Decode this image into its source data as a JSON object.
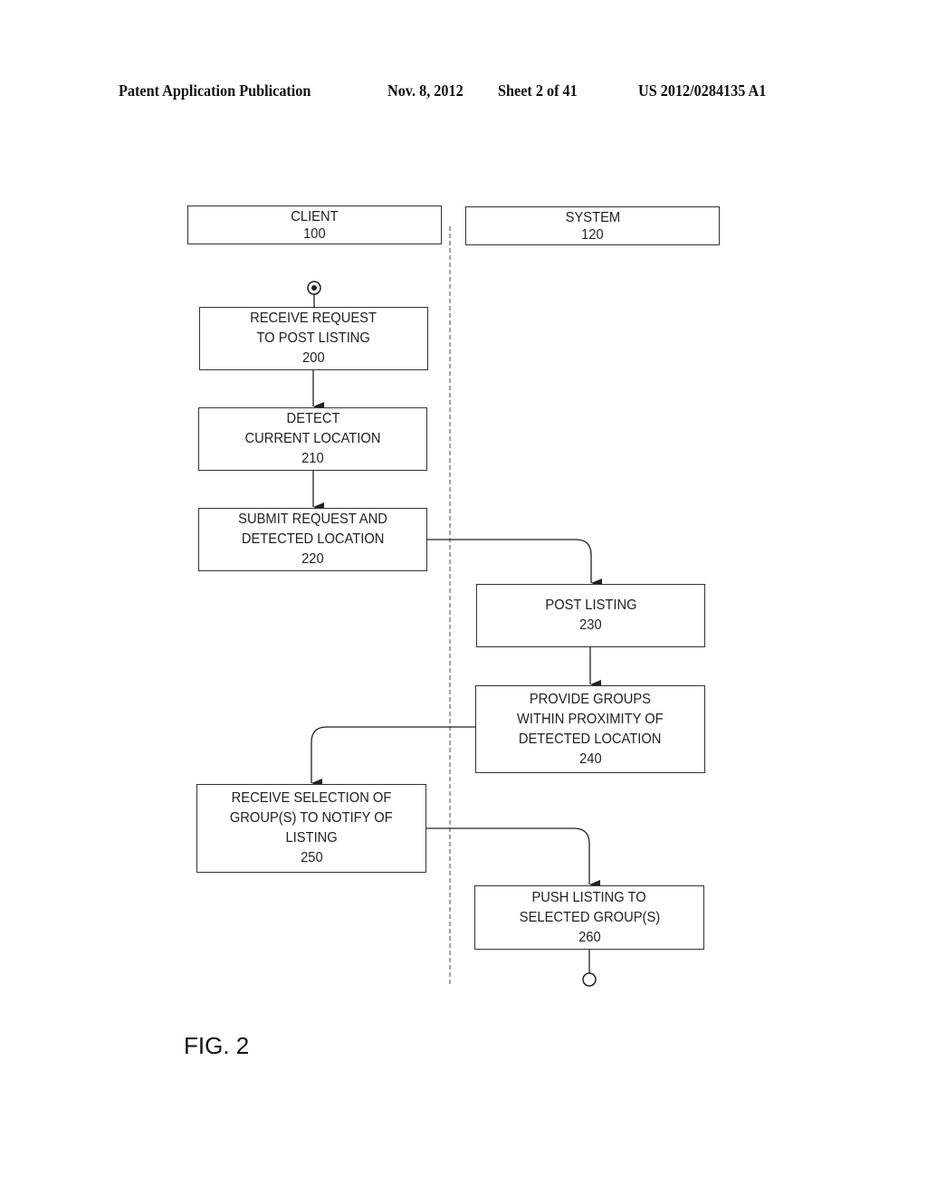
{
  "header": {
    "publication": "Patent Application Publication",
    "date": "Nov. 8, 2012",
    "sheet": "Sheet 2 of 41",
    "number": "US 2012/0284135 A1"
  },
  "lanes": [
    {
      "title": "CLIENT",
      "ref": "100"
    },
    {
      "title": "SYSTEM",
      "ref": "120"
    }
  ],
  "steps": [
    {
      "lines": [
        "RECEIVE REQUEST",
        "TO POST LISTING"
      ],
      "ref": "200",
      "lane": "CLIENT"
    },
    {
      "lines": [
        "DETECT",
        "CURRENT LOCATION"
      ],
      "ref": "210",
      "lane": "CLIENT"
    },
    {
      "lines": [
        "SUBMIT REQUEST AND",
        "DETECTED LOCATION"
      ],
      "ref": "220",
      "lane": "CLIENT"
    },
    {
      "lines": [
        "POST LISTING"
      ],
      "ref": "230",
      "lane": "SYSTEM"
    },
    {
      "lines": [
        "PROVIDE GROUPS",
        "WITHIN PROXIMITY OF",
        "DETECTED LOCATION"
      ],
      "ref": "240",
      "lane": "SYSTEM"
    },
    {
      "lines": [
        "RECEIVE SELECTION OF",
        "GROUP(S) TO NOTIFY OF",
        "LISTING"
      ],
      "ref": "250",
      "lane": "CLIENT"
    },
    {
      "lines": [
        "PUSH LISTING TO",
        "SELECTED GROUP(S)"
      ],
      "ref": "260",
      "lane": "SYSTEM"
    }
  ],
  "flow": [
    "start",
    "200",
    "210",
    "220",
    "230",
    "240",
    "250",
    "260",
    "end"
  ],
  "figure_label": "FIG. 2"
}
